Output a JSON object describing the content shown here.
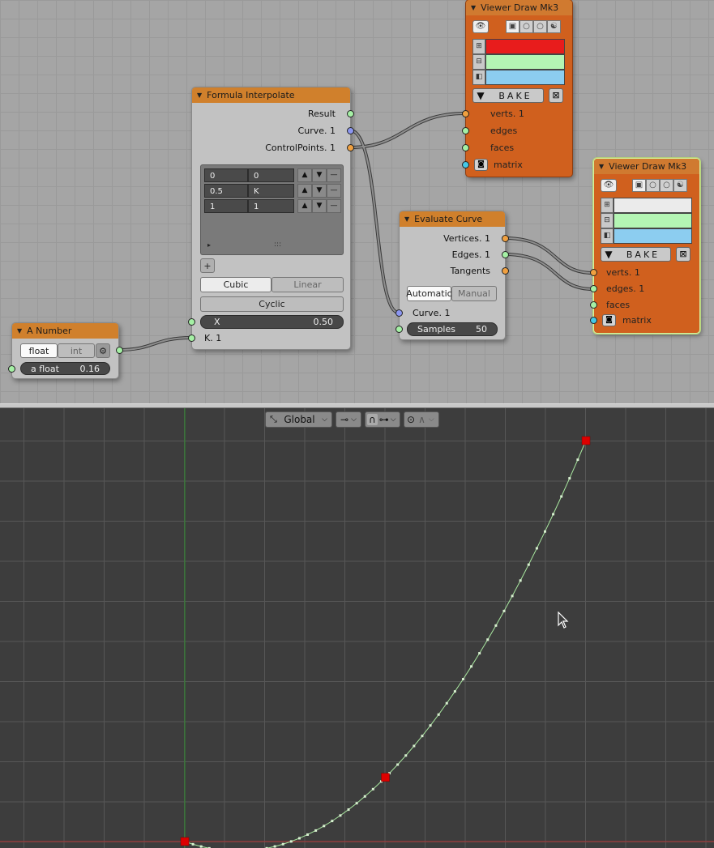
{
  "node_editor": {
    "formula_interpolate": {
      "title": "Formula Interpolate",
      "outputs": [
        "Result",
        "Curve. 1",
        "ControlPoints. 1"
      ],
      "points": [
        {
          "x": "0",
          "y": "0"
        },
        {
          "x": "0.5",
          "y": "K"
        },
        {
          "x": "1",
          "y": "1"
        }
      ],
      "row_buttons": [
        "▲",
        "▼",
        "—"
      ],
      "list_expand": "▸",
      "list_grip": ":::",
      "add_button": "+",
      "mode_options": [
        "Cubic",
        "Linear"
      ],
      "mode_selected": "Cubic",
      "cyclic_label": "Cyclic",
      "x_field": {
        "label": "X",
        "value": "0.50"
      },
      "input_k": "K. 1"
    },
    "a_number": {
      "title": "A Number",
      "type_options": [
        "float",
        "int"
      ],
      "type_selected": "float",
      "field": {
        "label": "a float",
        "value": "0.16"
      }
    },
    "evaluate_curve": {
      "title": "Evaluate Curve",
      "outputs": [
        "Vertices. 1",
        "Edges. 1",
        "Tangents"
      ],
      "mode_options": [
        "Automatic",
        "Manual"
      ],
      "mode_selected": "Automatic",
      "input_curve": "Curve. 1",
      "samples_field": {
        "label": "Samples",
        "value": "50"
      }
    },
    "viewer_draw_1": {
      "title": "Viewer Draw Mk3",
      "bake_label": "BAKE",
      "inputs": [
        "verts. 1",
        "edges",
        "faces",
        "matrix"
      ],
      "colors": [
        "#e81c1c",
        "#b4f5b4",
        "#8ccdf0"
      ]
    },
    "viewer_draw_2": {
      "title": "Viewer Draw Mk3",
      "bake_label": "BAKE",
      "inputs": [
        "verts. 1",
        "edges. 1",
        "faces",
        "matrix"
      ],
      "colors": [
        "#ebebeb",
        "#b4f5b4",
        "#8ccdf0"
      ]
    },
    "icons": {
      "eye": "👁",
      "gear": "⚙",
      "bake_triangle": "▼",
      "bake_clear": "⊠"
    }
  },
  "viewport": {
    "header": {
      "orientation": "Global"
    },
    "curve": {
      "control_points": [
        [
          0,
          0
        ],
        [
          0.5,
          0.16
        ],
        [
          1,
          1
        ]
      ],
      "samples": 50,
      "colors": {
        "line": "#a9e8a0",
        "vertex": "#d8f0d0",
        "control_point": "#dd0000",
        "x_axis": "#b03030",
        "y_axis": "#2a8a2a"
      }
    }
  }
}
